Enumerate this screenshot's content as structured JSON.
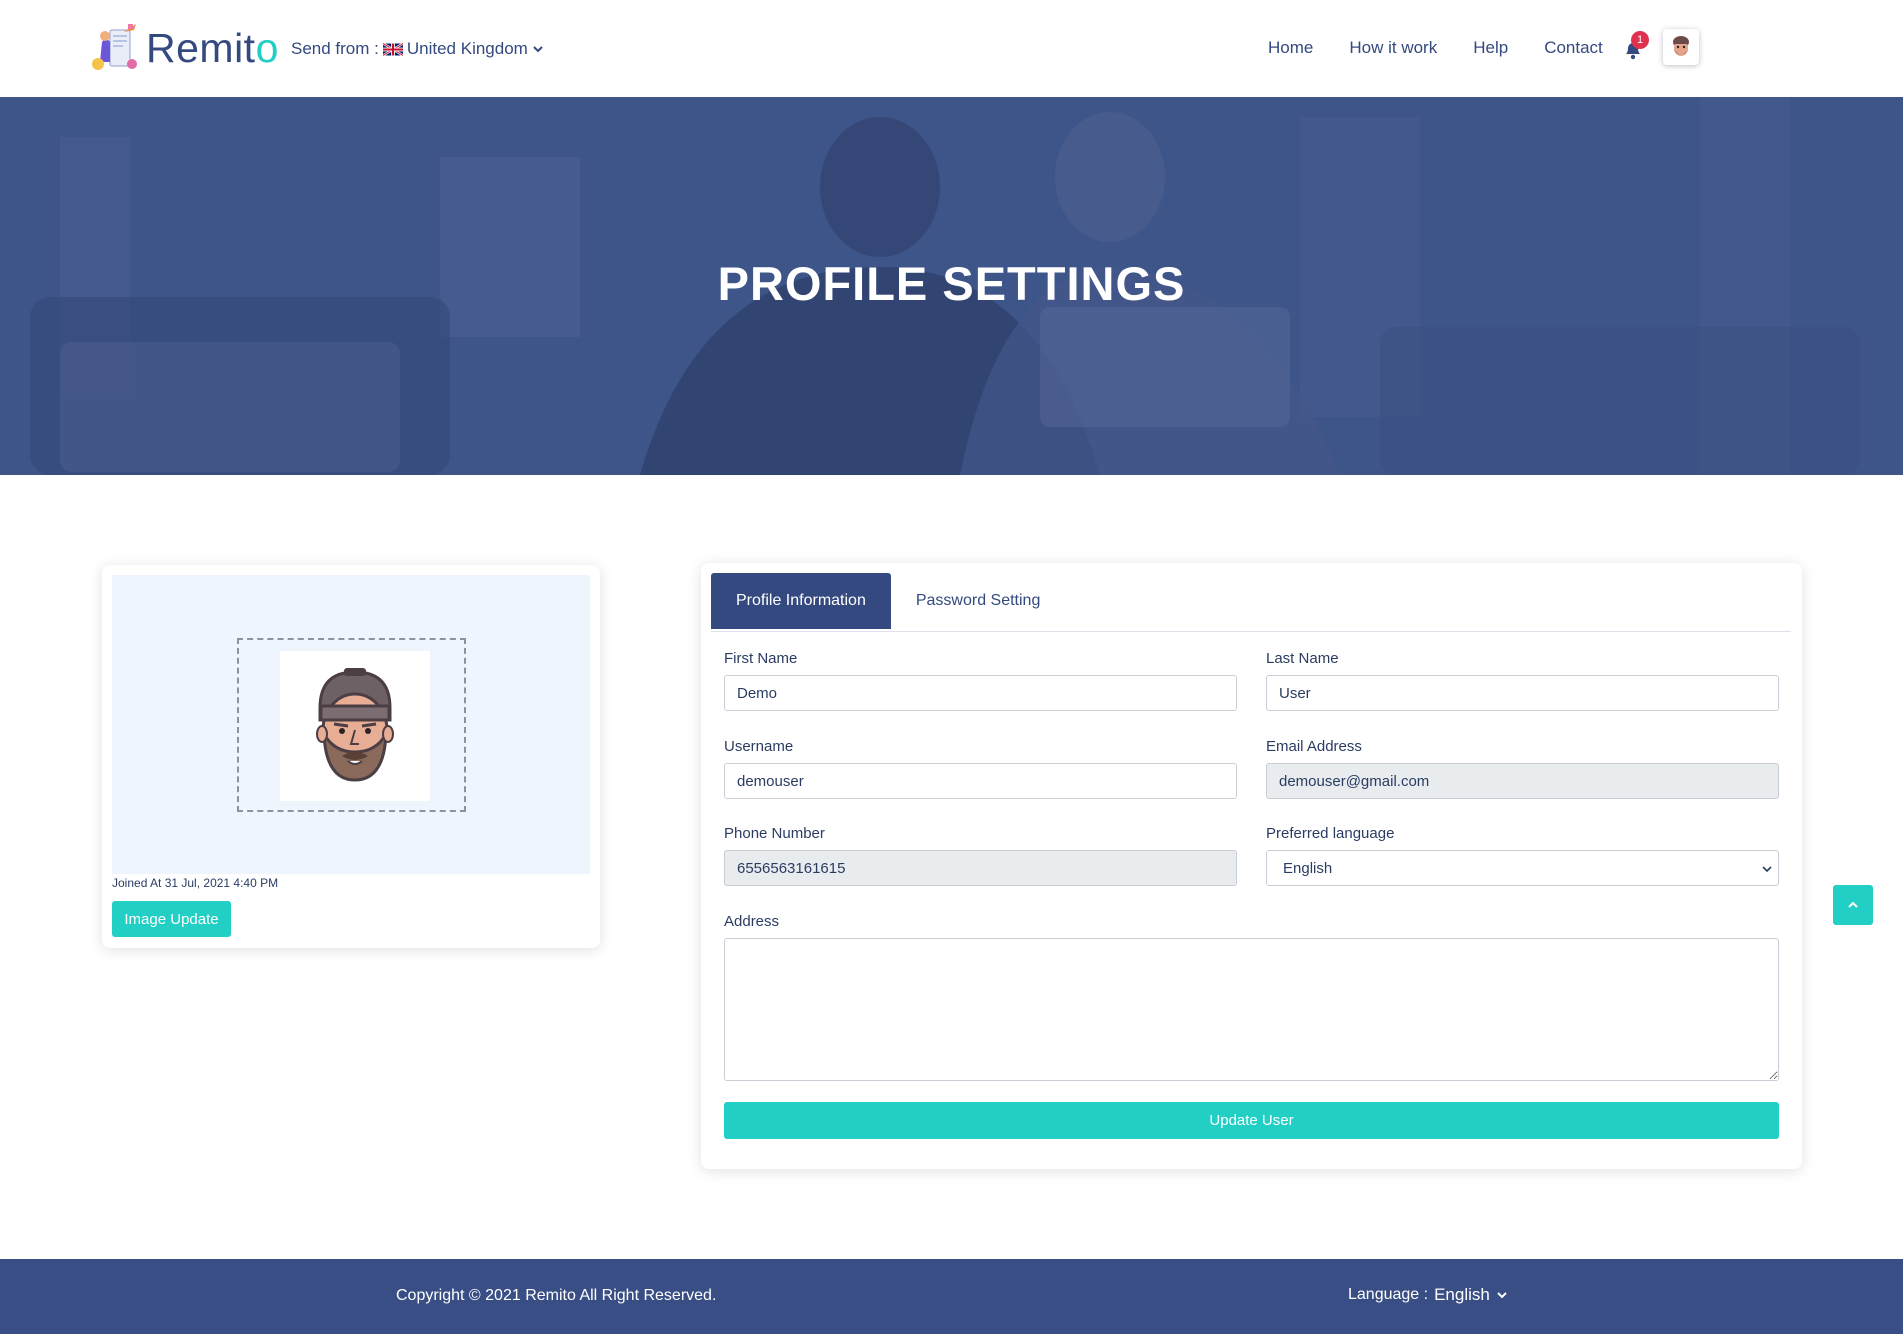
{
  "header": {
    "logo_text_main": "Remit",
    "logo_text_accent": "o",
    "send_from_label": "Send from :",
    "send_from_country": "United Kingdom",
    "nav": [
      "Home",
      "How it work",
      "Help",
      "Contact"
    ],
    "notification_count": "1"
  },
  "banner": {
    "title": "PROFILE SETTINGS"
  },
  "image_card": {
    "joined_text": "Joined At 31 Jul, 2021 4:40 PM",
    "update_button": "Image Update"
  },
  "tabs": [
    "Profile Information",
    "Password Setting"
  ],
  "form": {
    "first_name": {
      "label": "First Name",
      "value": "Demo"
    },
    "last_name": {
      "label": "Last Name",
      "value": "User"
    },
    "username": {
      "label": "Username",
      "value": "demouser"
    },
    "email": {
      "label": "Email Address",
      "value": "demouser@gmail.com"
    },
    "phone": {
      "label": "Phone Number",
      "value": "6556563161615"
    },
    "language": {
      "label": "Preferred language",
      "value": "English"
    },
    "address": {
      "label": "Address",
      "value": ""
    },
    "submit": "Update User"
  },
  "footer": {
    "copyright": "Copyright © 2021 Remito All Right Reserved.",
    "language_label": "Language :",
    "language_value": "English"
  },
  "colors": {
    "primary": "#34497f",
    "accent": "#22cfc4",
    "badge": "#e0314f",
    "banner_overlay": "#3b5389",
    "footer": "#384e84"
  }
}
